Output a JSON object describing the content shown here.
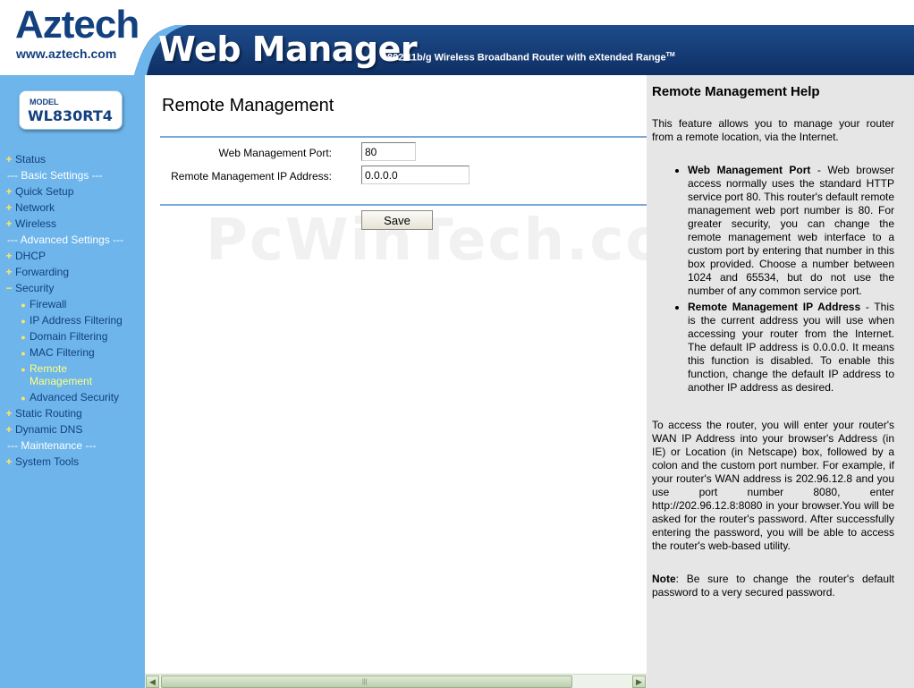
{
  "header": {
    "brand": "Aztech",
    "url": "www.aztech.com",
    "app_title": "Web Manager",
    "tagline": "802.11b/g Wireless Broadband Router with eXtended Range",
    "tagline_tm": "TM"
  },
  "model": {
    "label": "MODEL",
    "name": "WL830RT4"
  },
  "sidebar": {
    "items": [
      {
        "label": "Status"
      },
      {
        "label": "--- Basic Settings ---"
      },
      {
        "label": "Quick Setup"
      },
      {
        "label": "Network"
      },
      {
        "label": "Wireless"
      },
      {
        "label": "--- Advanced Settings ---"
      },
      {
        "label": "DHCP"
      },
      {
        "label": "Forwarding"
      },
      {
        "label": "Security"
      },
      {
        "label": "Firewall"
      },
      {
        "label": "IP Address Filtering"
      },
      {
        "label": "Domain Filtering"
      },
      {
        "label": "MAC Filtering"
      },
      {
        "label": "Remote",
        "label2": "Management"
      },
      {
        "label": "Advanced Security"
      },
      {
        "label": "Static Routing"
      },
      {
        "label": "Dynamic DNS"
      },
      {
        "label": "--- Maintenance ---"
      },
      {
        "label": "System Tools"
      }
    ]
  },
  "main": {
    "title": "Remote Management",
    "port_label": "Web Management Port:",
    "port_value": "80",
    "ip_label": "Remote Management IP Address:",
    "ip_value": "0.0.0.0",
    "save_label": "Save",
    "watermark": "PcWinTech.com"
  },
  "help": {
    "title": "Remote Management Help",
    "intro": "This feature allows you to manage your router from a remote location, via the Internet.",
    "bullets": [
      {
        "term": "Web Management Port",
        "text": " - Web browser access normally uses the standard HTTP service port 80. This router's default remote management web port number is 80. For greater security, you can change the remote management web interface to a custom port by entering that number in this box provided. Choose a number between 1024 and 65534, but do not use the number of any common service port."
      },
      {
        "term": "Remote Management IP Address",
        "text": " - This is the current address you will use when accessing your router from the Internet. The default IP address is 0.0.0.0. It means this function is disabled. To enable this function, change the default IP address to another IP address as desired."
      }
    ],
    "access": "To access the router, you will enter your router's WAN IP Address into your browser's Address (in IE) or Location (in Netscape) box, followed by a colon and the custom port number. For example, if your router's WAN address is 202.96.12.8 and you use port number 8080, enter http://202.96.12.8:8080 in your browser.You will be asked for the router's password. After successfully entering the password, you will be able to access the router's web-based utility.",
    "note_label": "Note",
    "note_text": ": Be sure to change the router's default password to a very secured password."
  },
  "colors": {
    "sidebar_bg": "#6db5ea",
    "header_band": "#1e4c8c",
    "nav_text": "#13407e",
    "active_item": "#ffff80",
    "help_bg": "#e6e6e6"
  }
}
